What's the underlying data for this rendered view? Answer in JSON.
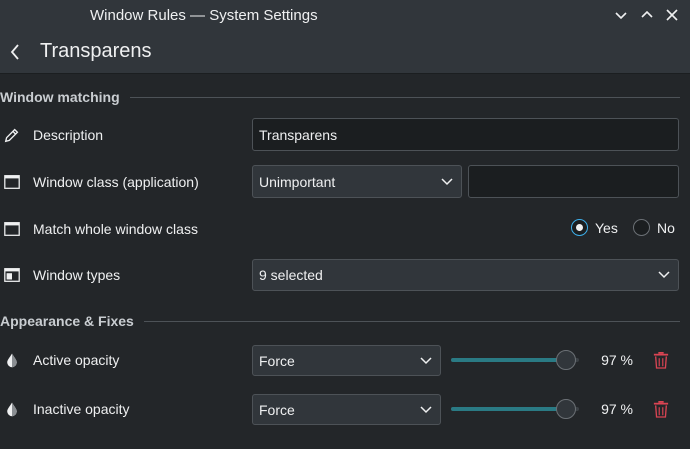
{
  "window": {
    "title": "Window Rules — System Settings"
  },
  "header": {
    "title": "Transparens"
  },
  "sections": {
    "matching": "Window matching",
    "appearance": "Appearance & Fixes"
  },
  "rows": {
    "description": {
      "label": "Description",
      "value": "Transparens"
    },
    "window_class": {
      "label": "Window class (application)",
      "combo": "Unimportant",
      "value": ""
    },
    "match_whole": {
      "label": "Match whole window class",
      "yes": "Yes",
      "no": "No",
      "selected": "Yes"
    },
    "window_types": {
      "label": "Window types",
      "combo": "9 selected"
    },
    "active_opacity": {
      "label": "Active opacity",
      "combo": "Force",
      "percent_text": "97 %",
      "value": 0.97
    },
    "inactive_opacity": {
      "label": "Inactive opacity",
      "combo": "Force",
      "percent_text": "97 %",
      "value": 0.97
    }
  },
  "colors": {
    "accent": "#3daee9",
    "slider_fill": "#2a7a84",
    "delete": "#da4453",
    "background": "#232629"
  }
}
